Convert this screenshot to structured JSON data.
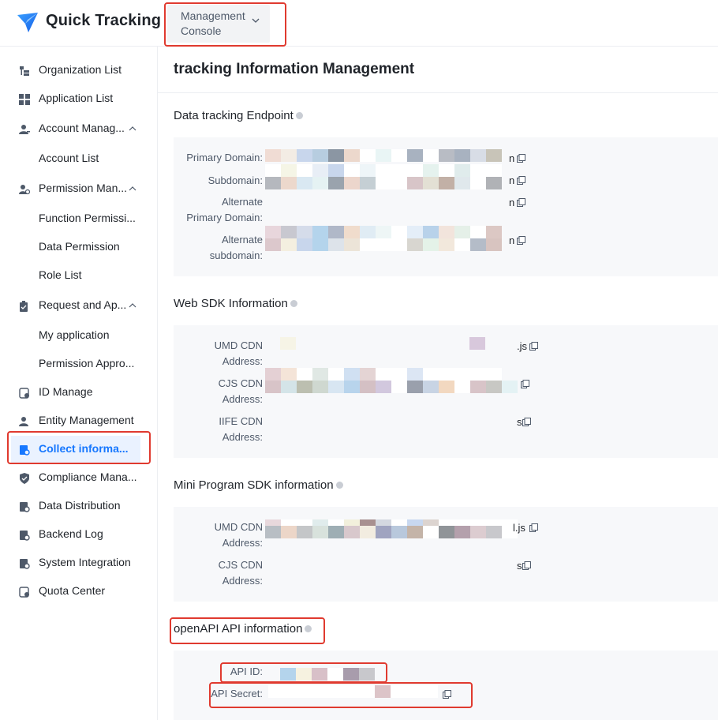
{
  "app": {
    "title": "Quick Tracking"
  },
  "header": {
    "console_label": "Management Console"
  },
  "sidebar": {
    "items": [
      {
        "label": "Organization List",
        "icon": "org-list-icon"
      },
      {
        "label": "Application List",
        "icon": "grid-icon"
      },
      {
        "label": "Account Manag...",
        "icon": "user-icon",
        "expanded": true
      },
      {
        "label": "Account List"
      },
      {
        "label": "Permission Man...",
        "icon": "permission-icon",
        "expanded": true
      },
      {
        "label": "Function Permissi..."
      },
      {
        "label": "Data Permission"
      },
      {
        "label": "Role List"
      },
      {
        "label": "Request and Ap...",
        "icon": "clipboard-icon",
        "expanded": true
      },
      {
        "label": "My application"
      },
      {
        "label": "Permission Appro..."
      },
      {
        "label": "ID Manage",
        "icon": "id-icon"
      },
      {
        "label": "Entity Management",
        "icon": "entity-icon"
      },
      {
        "label": "Collect informa...",
        "icon": "collect-icon",
        "active": true
      },
      {
        "label": "Compliance Mana...",
        "icon": "shield-icon"
      },
      {
        "label": "Data Distribution",
        "icon": "distribution-icon"
      },
      {
        "label": "Backend Log",
        "icon": "log-icon"
      },
      {
        "label": "System Integration",
        "icon": "integration-icon"
      },
      {
        "label": "Quota Center",
        "icon": "quota-icon"
      }
    ]
  },
  "main": {
    "title": "tracking Information Management",
    "endpoint": {
      "title": "Data tracking Endpoint",
      "fields": [
        {
          "label": "Primary Domain:",
          "tail": "n"
        },
        {
          "label": "Subdomain:",
          "tail": "n"
        },
        {
          "label_line1": "Alternate",
          "label_line2": "Primary Domain:",
          "tail": "n"
        },
        {
          "label_line1": "Alternate",
          "label_line2": "subdomain:",
          "tail": "n"
        }
      ]
    },
    "web_sdk": {
      "title": "Web SDK Information",
      "fields": [
        {
          "label_line1": "UMD CDN",
          "label_line2": "Address:",
          "tail": ".js"
        },
        {
          "label_line1": "CJS CDN",
          "label_line2": "Address:",
          "tail": ""
        },
        {
          "label_line1": "IIFE CDN",
          "label_line2": "Address:",
          "tail": "s"
        }
      ]
    },
    "mini_sdk": {
      "title": "Mini Program SDK information",
      "fields": [
        {
          "label_line1": "UMD CDN",
          "label_line2": "Address:",
          "tail": "l.js"
        },
        {
          "label_line1": "CJS CDN",
          "label_line2": "Address:",
          "tail": "s"
        }
      ]
    },
    "openapi": {
      "title": "openAPI API information",
      "fields": [
        {
          "label": "API ID:"
        },
        {
          "label": "API Secret:"
        }
      ]
    }
  },
  "colors": {
    "accent": "#1677ff",
    "highlight": "#e03a2f",
    "card_bg": "#f7f8fa",
    "active_bg": "#eaf2ff"
  }
}
